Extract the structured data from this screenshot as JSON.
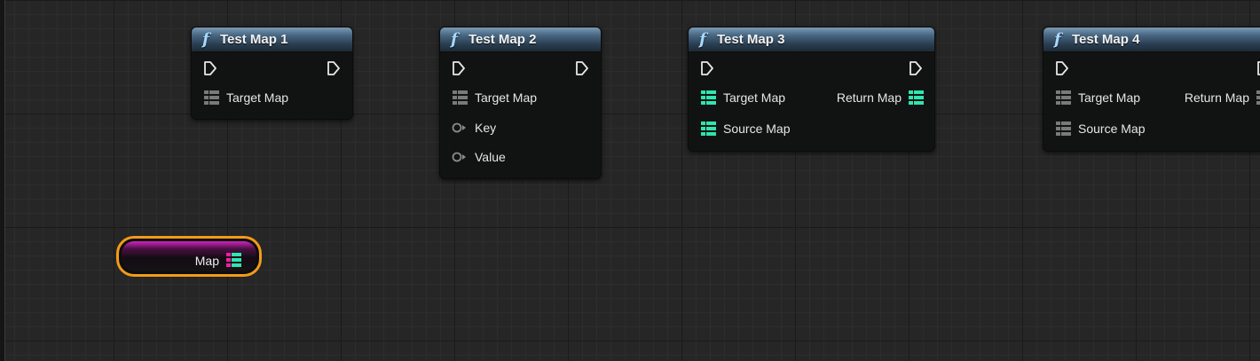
{
  "colors": {
    "header_accent": "#4a6a86",
    "map_pin_unconnected": "#7a7a7a",
    "map_pin_typed": "#2ee6b0",
    "map_key_color": "#ff1aa8",
    "selection_outline": "#f29b18"
  },
  "nodes": [
    {
      "title": "Test Map 1",
      "inputs": [
        {
          "label": "Target Map",
          "icon": "map-icon"
        }
      ],
      "outputs": []
    },
    {
      "title": "Test Map 2",
      "inputs": [
        {
          "label": "Target Map",
          "icon": "map-icon"
        },
        {
          "label": "Key",
          "icon": "wildcard-pin-icon"
        },
        {
          "label": "Value",
          "icon": "wildcard-pin-icon"
        }
      ],
      "outputs": []
    },
    {
      "title": "Test Map 3",
      "inputs": [
        {
          "label": "Target Map",
          "icon": "map-icon"
        },
        {
          "label": "Source Map",
          "icon": "map-icon"
        }
      ],
      "outputs": [
        {
          "label": "Return Map",
          "icon": "map-icon"
        }
      ]
    },
    {
      "title": "Test Map 4",
      "inputs": [
        {
          "label": "Target Map",
          "icon": "map-icon"
        },
        {
          "label": "Source Map",
          "icon": "map-icon"
        }
      ],
      "outputs": [
        {
          "label": "Return Map",
          "icon": "map-icon"
        }
      ]
    }
  ],
  "variable_node": {
    "label": "Map",
    "icon": "map-icon"
  }
}
